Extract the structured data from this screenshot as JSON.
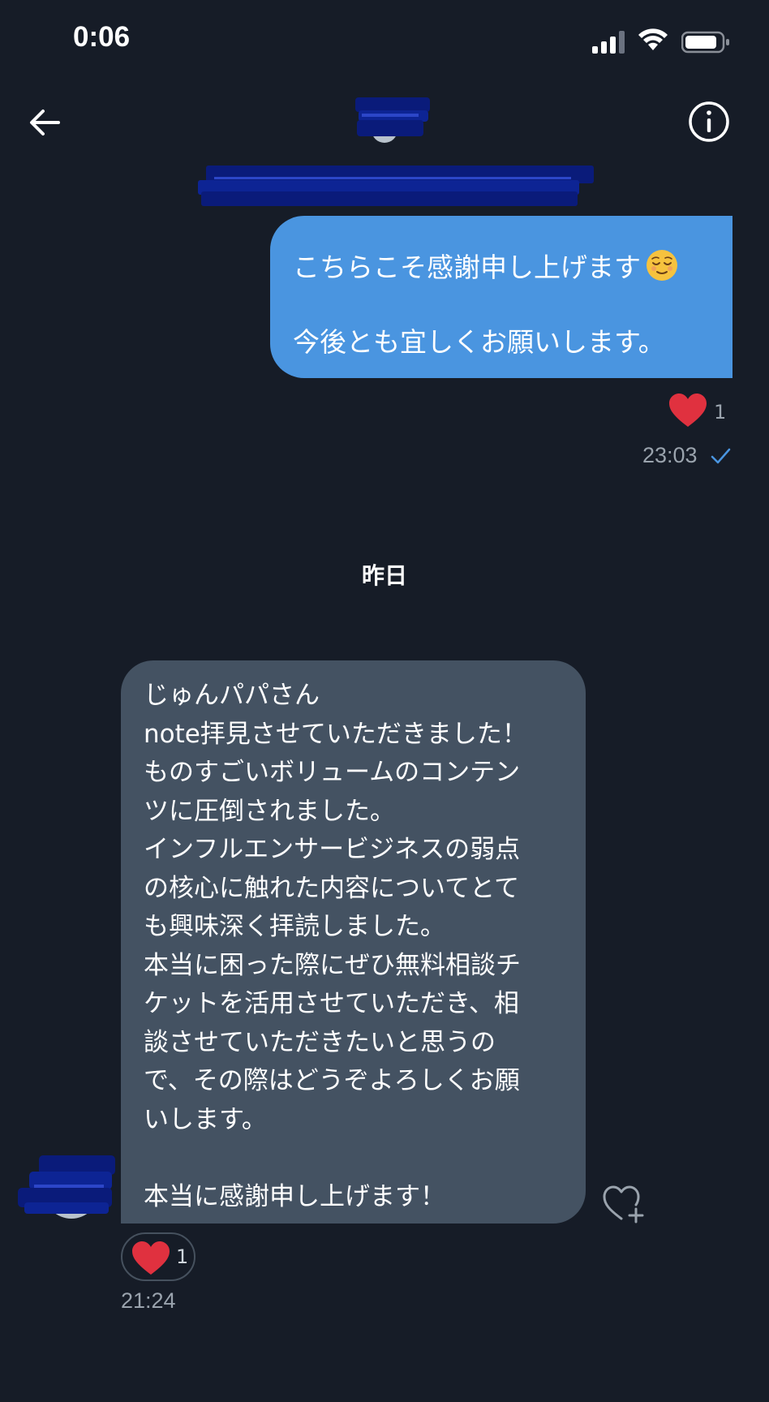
{
  "status_bar": {
    "time": "0:06",
    "icons": [
      "cellular-signal-icon",
      "wifi-icon",
      "battery-icon"
    ]
  },
  "header": {
    "back_icon": "arrow-left-icon",
    "info_icon": "info-icon",
    "avatar": "redacted-avatar",
    "name": "redacted-name"
  },
  "messages": [
    {
      "direction": "sent",
      "lines": [
        "こちらこそ感謝申し上げます",
        "今後とも宜しくお願いします。"
      ],
      "emoji": "relieved-face-emoji",
      "reaction": {
        "icon": "heart-icon",
        "count": "1"
      },
      "time": "23:03",
      "status_icon": "checkmark-icon"
    },
    {
      "direction": "received",
      "lines": [
        "じゅんパパさん",
        "note拝見させていただきました！",
        "ものすごいボリュームのコンテン",
        "ツに圧倒されました。",
        "インフルエンサービジネスの弱点",
        "の核心に触れた内容についてとて",
        "も興味深く拝読しました。",
        "本当に困った際にぜひ無料相談チ",
        "ケットを活用させていただき、相",
        "談させていただきたいと思うの",
        "で、その際はどうぞよろしくお願",
        "いします。",
        "",
        "本当に感謝申し上げます！"
      ],
      "reaction": {
        "icon": "heart-icon",
        "count": "1"
      },
      "add_reaction_icon": "heart-add-icon",
      "time": "21:24"
    }
  ],
  "date_separator": "昨日",
  "colors": {
    "background": "#161c27",
    "sent_bubble": "#4a95e0",
    "received_bubble": "#445262",
    "heart": "#e0313f",
    "redaction": "#0a1b7a"
  }
}
